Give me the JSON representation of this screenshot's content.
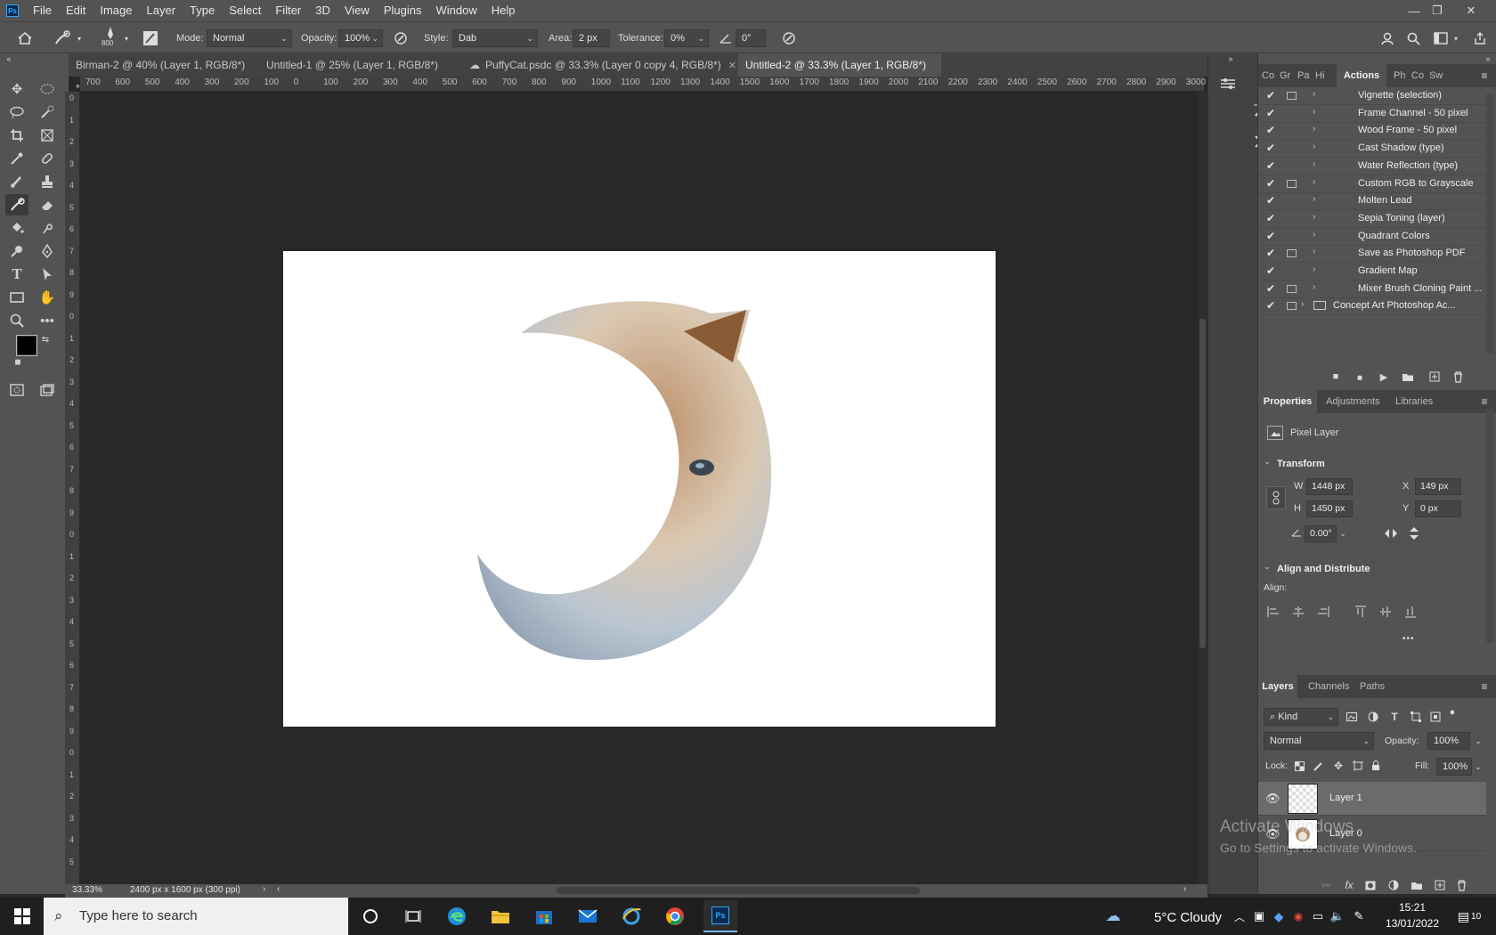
{
  "app": {
    "logo": "Ps"
  },
  "menu": [
    "File",
    "Edit",
    "Image",
    "Layer",
    "Type",
    "Select",
    "Filter",
    "3D",
    "View",
    "Plugins",
    "Window",
    "Help"
  ],
  "window_controls": {
    "minimize": "—",
    "restore": "❐",
    "close": "✕"
  },
  "options": {
    "brush_size": "800",
    "mode_label": "Mode:",
    "mode_value": "Normal",
    "opacity_label": "Opacity:",
    "opacity_value": "100%",
    "style_label": "Style:",
    "style_value": "Dab",
    "area_label": "Area:",
    "area_value": "2 px",
    "tolerance_label": "Tolerance:",
    "tolerance_value": "0%",
    "angle_value": "0°"
  },
  "doc_tabs": [
    {
      "label": "Birman-2 @ 40% (Layer 1, RGB/8*) *"
    },
    {
      "label": "Untitled-1 @ 25% (Layer 1, RGB/8*) *"
    },
    {
      "label": "PuffyCat.psdc @ 33.3% (Layer 0 copy 4, RGB/8*)"
    },
    {
      "label": "Untitled-2 @ 33.3% (Layer 1, RGB/8*) *"
    }
  ],
  "hruler": [
    "700",
    "600",
    "500",
    "400",
    "300",
    "200",
    "100",
    "0",
    "100",
    "200",
    "300",
    "400",
    "500",
    "600",
    "700",
    "800",
    "900",
    "1000",
    "1100",
    "1200",
    "1300",
    "1400",
    "1500",
    "1600",
    "1700",
    "1800",
    "1900",
    "2000",
    "2100",
    "2200",
    "2300",
    "2400",
    "2500",
    "2600",
    "2700",
    "2800",
    "2900",
    "3000"
  ],
  "vruler": [
    "0",
    "1",
    "2",
    "3",
    "4",
    "5",
    "6",
    "7",
    "8",
    "9",
    "0",
    "1",
    "2",
    "3",
    "4",
    "5",
    "6",
    "7",
    "8",
    "9",
    "0",
    "1",
    "2",
    "3",
    "4",
    "5",
    "6",
    "7",
    "8",
    "9",
    "0",
    "1",
    "2",
    "3",
    "4",
    "5"
  ],
  "status": {
    "zoom": "33.33%",
    "doc_info": "2400 px x 1600 px (300 ppi)"
  },
  "top_panel_tabs": [
    "Co",
    "Gr",
    "Pa",
    "Hi",
    "Actions",
    "Ph",
    "Co",
    "Sw"
  ],
  "actions": [
    {
      "name": "Vignette (selection)",
      "dialog": true
    },
    {
      "name": "Frame Channel - 50 pixel",
      "dialog": false
    },
    {
      "name": "Wood Frame - 50 pixel",
      "dialog": false
    },
    {
      "name": "Cast Shadow (type)",
      "dialog": false
    },
    {
      "name": "Water Reflection (type)",
      "dialog": false
    },
    {
      "name": "Custom RGB to Grayscale",
      "dialog": true
    },
    {
      "name": "Molten Lead",
      "dialog": false
    },
    {
      "name": "Sepia Toning (layer)",
      "dialog": false
    },
    {
      "name": "Quadrant Colors",
      "dialog": false
    },
    {
      "name": "Save as Photoshop PDF",
      "dialog": true
    },
    {
      "name": "Gradient Map",
      "dialog": false
    },
    {
      "name": "Mixer Brush Cloning Paint ...",
      "dialog": true
    },
    {
      "name": "Concept Art Photoshop Ac...",
      "dialog": true
    }
  ],
  "props_tabs": [
    "Properties",
    "Adjustments",
    "Libraries"
  ],
  "properties": {
    "kind": "Pixel Layer",
    "transform_title": "Transform",
    "w_label": "W",
    "w_value": "1448 px",
    "h_label": "H",
    "h_value": "1450 px",
    "x_label": "X",
    "x_value": "149 px",
    "y_label": "Y",
    "y_value": "0 px",
    "angle_value": "0.00°",
    "align_title": "Align and Distribute",
    "align_label": "Align:",
    "more": "•••"
  },
  "layers_tabs": [
    "Layers",
    "Channels",
    "Paths"
  ],
  "layers": {
    "filter": "Kind",
    "blend": "Normal",
    "opacity_label": "Opacity:",
    "opacity_value": "100%",
    "lock_label": "Lock:",
    "fill_label": "Fill:",
    "fill_value": "100%",
    "items": [
      {
        "name": "Layer 1",
        "selected": true
      },
      {
        "name": "Layer 0",
        "selected": false
      }
    ]
  },
  "watermark": {
    "title": "Activate Windows",
    "subtitle": "Go to Settings to activate Windows."
  },
  "taskbar": {
    "search_placeholder": "Type here to search",
    "weather": "5°C  Cloudy",
    "time": "15:21",
    "date": "13/01/2022",
    "notification_count": "10"
  },
  "colors": {
    "accent": "#31a8ff",
    "panel": "#535353",
    "canvas_bg": "#282828",
    "foreground_swatch": "#000000",
    "background_swatch": "#ffffff"
  }
}
